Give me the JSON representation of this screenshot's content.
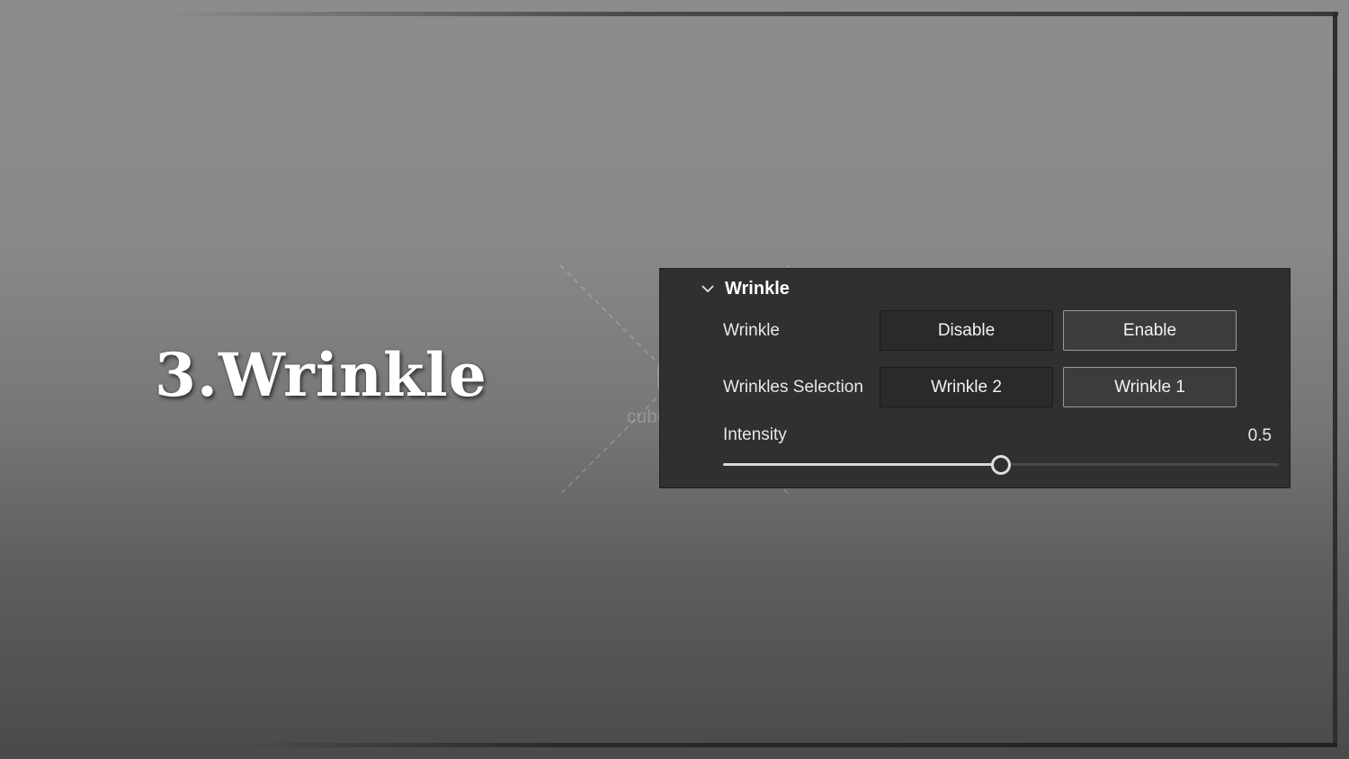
{
  "slide": {
    "title": "3.Wrinkle"
  },
  "watermark": {
    "text": "cubebrush",
    "icon": "cubebrush-logo-icon"
  },
  "panel": {
    "title": "Wrinkle",
    "collapse_icon": "chevron-down-icon",
    "rows": {
      "wrinkle": {
        "label": "Wrinkle",
        "options": [
          "Disable",
          "Enable"
        ],
        "selected": "Enable"
      },
      "selection": {
        "label": "Wrinkles Selection",
        "options": [
          "Wrinkle 2",
          "Wrinkle 1"
        ],
        "selected": "Wrinkle 1"
      }
    },
    "intensity": {
      "label": "Intensity",
      "value": 0.5,
      "value_text": "0.5",
      "fill_fraction": 0.5
    }
  },
  "colors": {
    "panel_bg": "#303030",
    "active_border": "#9a9a9a",
    "text": "#e8e8e8"
  }
}
